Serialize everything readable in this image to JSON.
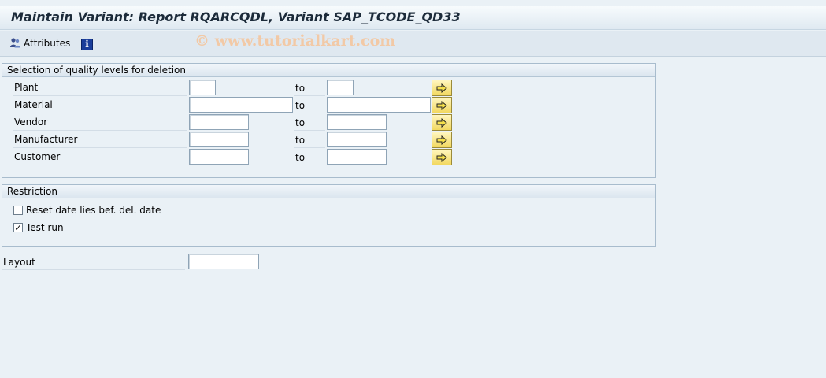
{
  "title": "Maintain Variant: Report RQARCQDL, Variant SAP_TCODE_QD33",
  "watermark": "© www.tutorialkart.com",
  "toolbar": {
    "attributes_label": "Attributes",
    "attributes_icon": "attributes-icon",
    "info_icon": "info-icon",
    "info_glyph": "i"
  },
  "selection_group": {
    "title": "Selection of quality levels for deletion",
    "to_label": "to",
    "rows": [
      {
        "label": "Plant",
        "from_value": "",
        "to_value": ""
      },
      {
        "label": "Material",
        "from_value": "",
        "to_value": ""
      },
      {
        "label": "Vendor",
        "from_value": "",
        "to_value": ""
      },
      {
        "label": "Manufacturer",
        "from_value": "",
        "to_value": ""
      },
      {
        "label": "Customer",
        "from_value": "",
        "to_value": ""
      }
    ]
  },
  "restriction_group": {
    "title": "Restriction",
    "reset_date_label": "Reset date lies bef. del. date",
    "reset_date_checked": false,
    "test_run_label": "Test run",
    "test_run_checked": true,
    "check_glyph": "✓"
  },
  "layout": {
    "label": "Layout",
    "value": ""
  },
  "colors": {
    "background": "#eaf1f6",
    "header_text": "#1c2b3a",
    "multiple_selection_button": "#f2d860",
    "info_icon": "#1a3d9a",
    "watermark": "#f2c9a6"
  }
}
